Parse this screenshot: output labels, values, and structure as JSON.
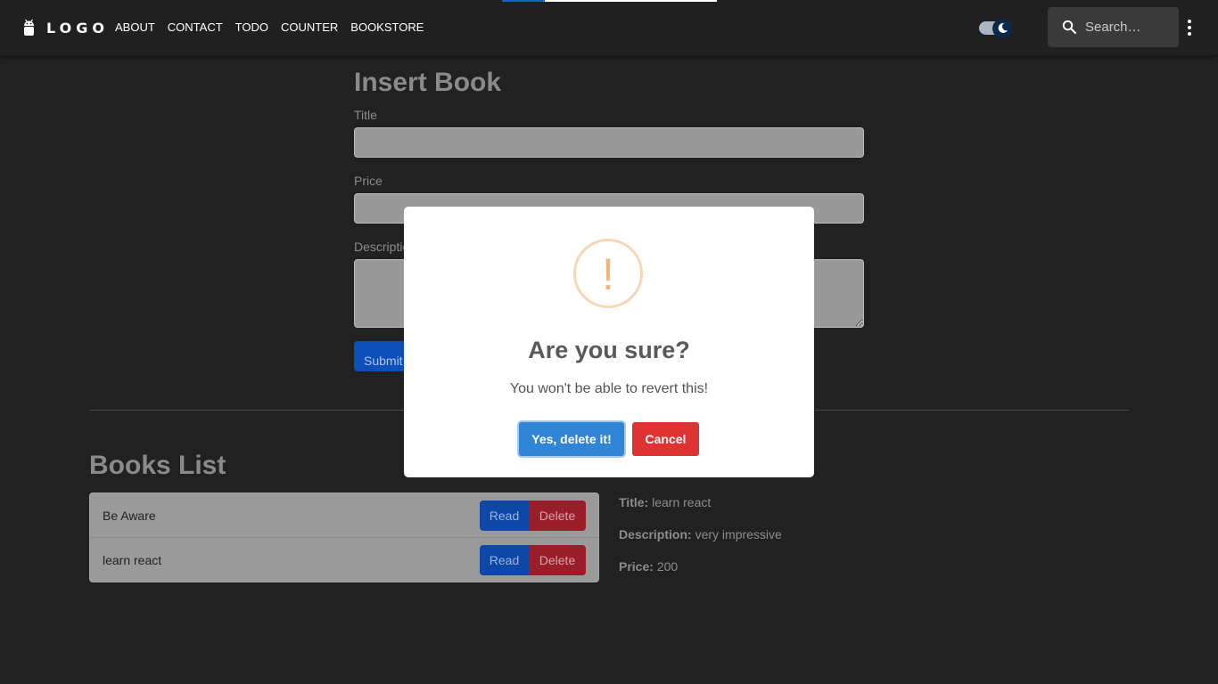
{
  "header": {
    "logo_text": "LOGO",
    "nav": [
      "ABOUT",
      "CONTACT",
      "TODO",
      "COUNTER",
      "BOOKSTORE"
    ],
    "search_placeholder": "Search…"
  },
  "form": {
    "heading": "Insert Book",
    "title_label": "Title",
    "price_label": "Price",
    "description_label": "Description",
    "submit_label": "Submit"
  },
  "books": {
    "heading": "Books List",
    "items": [
      {
        "title": "Be Aware",
        "read_label": "Read",
        "delete_label": "Delete"
      },
      {
        "title": "learn react",
        "read_label": "Read",
        "delete_label": "Delete"
      }
    ],
    "detail": {
      "title_label": "Title:",
      "title_value": "learn react",
      "description_label": "Description:",
      "description_value": "very impressive",
      "price_label": "Price:",
      "price_value": "200"
    }
  },
  "dialog": {
    "icon_glyph": "!",
    "title": "Are you sure?",
    "text": "You won't be able to revert this!",
    "confirm_label": "Yes, delete it!",
    "cancel_label": "Cancel"
  },
  "colors": {
    "primary": "#3085d6",
    "danger": "#dd3333",
    "warning": "#f8bb86"
  }
}
